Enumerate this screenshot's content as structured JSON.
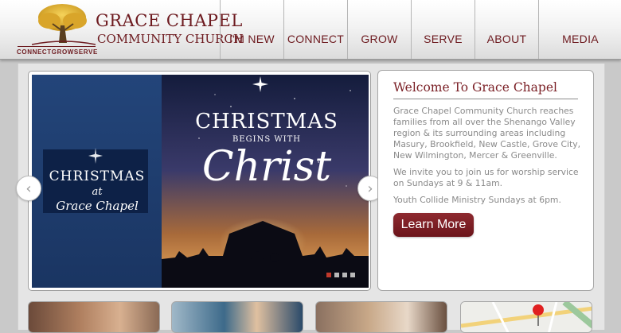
{
  "header": {
    "logo": {
      "line1": "GRACE CHAPEL",
      "line2": "COMMUNITY CHURCH",
      "tagline": "CONNECTGROWSERVE"
    },
    "nav": [
      {
        "label": "I'M NEW"
      },
      {
        "label": "CONNECT"
      },
      {
        "label": "GROW"
      },
      {
        "label": "SERVE"
      },
      {
        "label": "ABOUT"
      },
      {
        "label": "MEDIA"
      }
    ]
  },
  "slider": {
    "left_panel": {
      "line1": "CHRISTMAS",
      "line2": "at",
      "line3": "Grace Chapel"
    },
    "main": {
      "line1": "CHRISTMAS",
      "line2": "BEGINS WITH",
      "line3": "Christ"
    },
    "prev_icon": "chevron-left-icon",
    "next_icon": "chevron-right-icon",
    "prev_glyph": "‹",
    "next_glyph": "›",
    "dot_count": 4,
    "active_dot": 0
  },
  "welcome": {
    "title": "Welcome To Grace Chapel",
    "paragraph1": "Grace Chapel Community Church reaches families from all over the Shenango Valley region & its surrounding areas including Masury, Brookfield, New Castle, Grove City, New Wilmington, Mercer & Greenville.",
    "paragraph2": "We invite you to join us for worship service on Sundays at 9 & 11am.",
    "paragraph3": "Youth Collide Ministry Sundays at 6pm.",
    "button": "Learn More"
  },
  "colors": {
    "brand": "#6d1a1f",
    "button": "#7a1f25",
    "active_dot": "#c0392b"
  }
}
